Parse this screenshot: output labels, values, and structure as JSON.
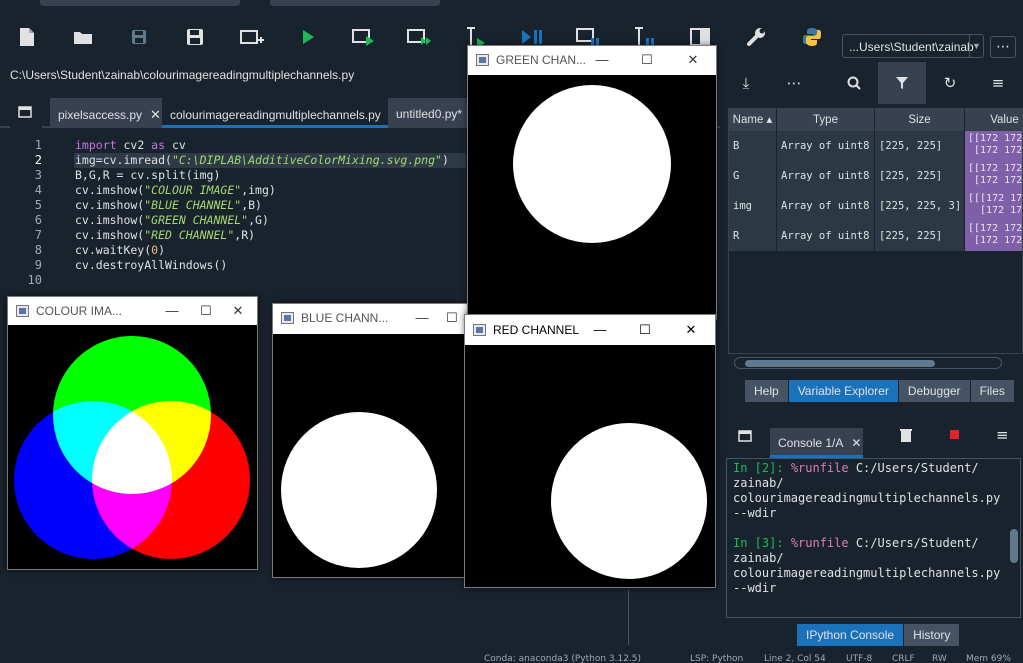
{
  "toolbar": {
    "icons": [
      "new-file-icon",
      "open-folder-icon",
      "save-icon",
      "save-all-icon",
      "new-cell-icon",
      "run-icon",
      "run-cell-icon",
      "run-cell-advance-icon",
      "run-selection-icon",
      "debug-icon",
      "debug-cell-icon",
      "debug-selection-icon",
      "maximize-pane-icon",
      "preferences-icon",
      "python-path-icon"
    ],
    "working_dir": "...Users\\Student\\zainab"
  },
  "editor": {
    "file_path": "C:\\Users\\Student\\zainab\\colourimagereadingmultiplechannels.py",
    "tabs": [
      {
        "label": "pixelsaccess.py",
        "active": false
      },
      {
        "label": "colourimagereadingmultiplechannels.py",
        "active": true
      },
      {
        "label": "untitled0.py*",
        "active": false
      }
    ],
    "lines": [
      {
        "n": "1",
        "code": "import cv2 as cv"
      },
      {
        "n": "2",
        "code": "img=cv.imread(\"C:\\DIPLAB\\AdditiveColorMixing.svg.png\")"
      },
      {
        "n": "3",
        "code": "B,G,R = cv.split(img)"
      },
      {
        "n": "4",
        "code": "cv.imshow(\"COLOUR IMAGE\",img)"
      },
      {
        "n": "5",
        "code": "cv.imshow(\"BLUE CHANNEL\",B)"
      },
      {
        "n": "6",
        "code": "cv.imshow(\"GREEN CHANNEL\",G)"
      },
      {
        "n": "7",
        "code": "cv.imshow(\"RED CHANNEL\",R)"
      },
      {
        "n": "8",
        "code": "cv.waitKey(0)"
      },
      {
        "n": "9",
        "code": "cv.destroyAllWindows()"
      },
      {
        "n": "10",
        "code": ""
      }
    ]
  },
  "variables": {
    "headers": [
      "Name",
      "Type",
      "Size",
      "Value"
    ],
    "rows": [
      {
        "name": "B",
        "type": "Array of uint8",
        "size": "[225, 225]",
        "value": "[[172 172\n [172 172"
      },
      {
        "name": "G",
        "type": "Array of uint8",
        "size": "[225, 225]",
        "value": "[[172 172\n [172 172"
      },
      {
        "name": "img",
        "type": "Array of uint8",
        "size": "[225, 225, 3]",
        "value": "[[[172 172\n  [172 172"
      },
      {
        "name": "R",
        "type": "Array of uint8",
        "size": "[225, 225]",
        "value": "[[172 172\n [172 172"
      }
    ],
    "bottom_tabs": [
      "Help",
      "Variable Explorer",
      "Debugger",
      "Files"
    ],
    "active_tab": "Variable Explorer"
  },
  "console": {
    "tab_label": "Console 1/A",
    "lines": [
      {
        "prompt": "In [2]:",
        "magic": "%runfile",
        "rest": " C:/Users/Student/"
      },
      {
        "text": "zainab/"
      },
      {
        "text": "colourimagereadingmultiplechannels.py"
      },
      {
        "text": "--wdir"
      },
      {
        "text": ""
      },
      {
        "prompt": "In [3]:",
        "magic": "%runfile",
        "rest": " C:/Users/Student/"
      },
      {
        "text": "zainab/"
      },
      {
        "text": "colourimagereadingmultiplechannels.py"
      },
      {
        "text": "--wdir"
      }
    ],
    "bottom_tabs": [
      "IPython Console",
      "History"
    ],
    "active_tab": "IPython Console"
  },
  "windows": {
    "colour": {
      "title": "COLOUR IMA..."
    },
    "blue": {
      "title": "BLUE CHANN..."
    },
    "green": {
      "title": "GREEN CHAN..."
    },
    "red": {
      "title": "RED CHANNEL"
    }
  },
  "statusbar": {
    "items": [
      "Conda: anaconda3 (Python 3.12.5)",
      "LSP: Python",
      "Line 2, Col 54",
      "UTF-8",
      "CRLF",
      "RW",
      "Mem 69%"
    ]
  },
  "colors": {
    "background": "#19232d",
    "panel": "#37414f",
    "accent": "#1a72bb",
    "value_cell": "#7e5fa8",
    "run_green": "#1db954",
    "keyword": "#c678dd"
  }
}
